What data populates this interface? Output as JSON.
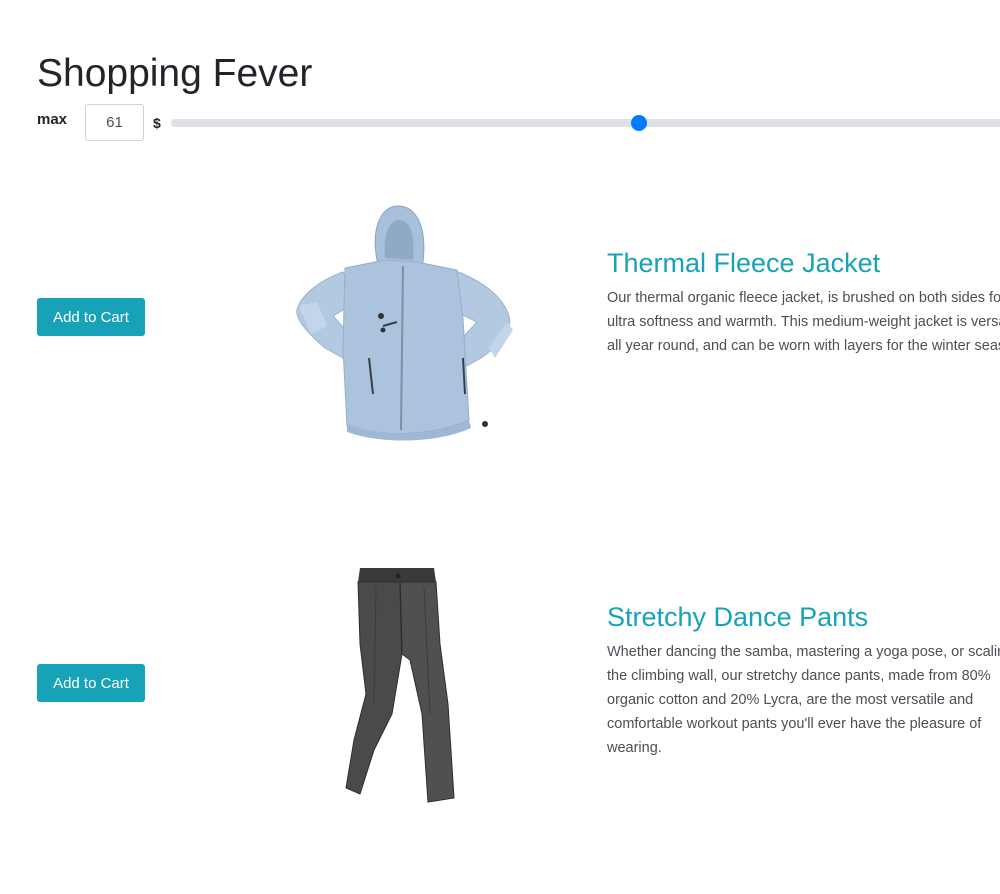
{
  "header": {
    "title": "Shopping Fever"
  },
  "filter": {
    "label": "max",
    "value": "61",
    "currency": "$",
    "slider_min": 0,
    "slider_max": 112,
    "slider_value": 61
  },
  "products": [
    {
      "name": "Thermal Fleece Jacket",
      "description": "Our thermal organic fleece jacket, is brushed on both sides for ultra softness and warmth. This medium-weight jacket is versatile all year round, and can be worn with layers for the winter season.",
      "button_label": "Add to Cart",
      "image_icon": "fleece-jacket-image"
    },
    {
      "name": "Stretchy Dance Pants",
      "description": "Whether dancing the samba, mastering a yoga pose, or scaling the climbing wall, our stretchy dance pants, made from 80% organic cotton and 20% Lycra, are the most versatile and comfortable workout pants you'll ever have the pleasure of wearing.",
      "button_label": "Add to Cart",
      "image_icon": "dance-pants-image"
    }
  ],
  "colors": {
    "accent": "#17a2b8",
    "slider_thumb": "#007bff",
    "slider_track": "#dee2e6"
  }
}
